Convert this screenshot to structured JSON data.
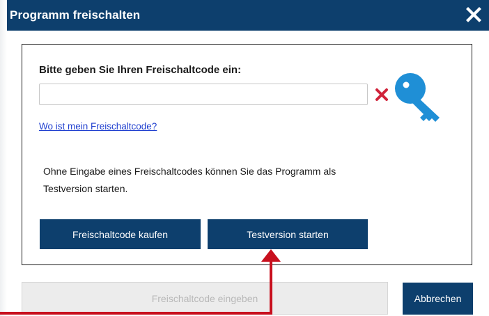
{
  "dialog": {
    "title": "Programm freischalten",
    "close_icon": "close-icon"
  },
  "panel": {
    "prompt": "Bitte geben Sie Ihren Freischaltcode ein:",
    "code_input": {
      "value": "",
      "placeholder": ""
    },
    "invalid_icon": "x-mark-icon",
    "key_icon": "key-icon",
    "help_link": "Wo ist mein Freischaltcode?",
    "info_line1": "Ohne Eingabe eines Freischaltcodes können Sie das Programm als",
    "info_line2": "Testversion starten.",
    "buy_button": "Freischaltcode kaufen",
    "test_button": "Testversion starten"
  },
  "footer": {
    "enter_button": "Freischaltcode eingeben",
    "cancel_button": "Abbrechen"
  },
  "colors": {
    "brand": "#0d3f6d",
    "error": "#d0233a",
    "key": "#1f8fd6",
    "link": "#1f3fcf",
    "annotation_arrow": "#c8101e"
  }
}
